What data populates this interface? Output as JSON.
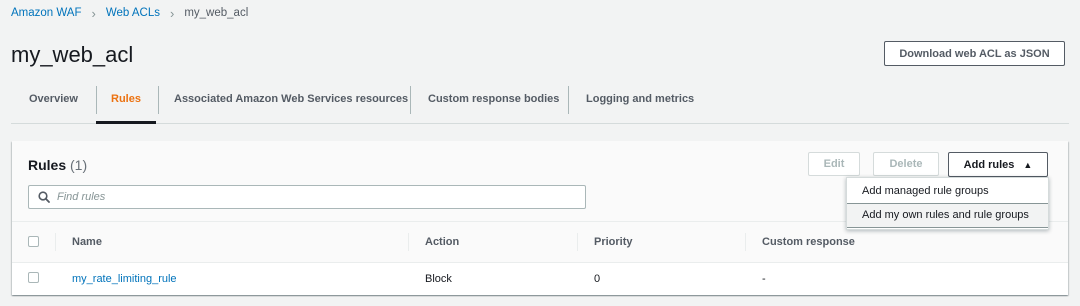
{
  "breadcrumb": {
    "items": [
      {
        "label": "Amazon WAF"
      },
      {
        "label": "Web ACLs"
      },
      {
        "label": "my_web_acl"
      }
    ]
  },
  "page": {
    "title": "my_web_acl",
    "download_label": "Download web ACL as JSON"
  },
  "tabs": [
    {
      "label": "Overview"
    },
    {
      "label": "Rules",
      "active": true
    },
    {
      "label": "Associated Amazon Web Services resources"
    },
    {
      "label": "Custom response bodies"
    },
    {
      "label": "Logging and metrics"
    }
  ],
  "rules_panel": {
    "title": "Rules",
    "count": "(1)",
    "edit_label": "Edit",
    "delete_label": "Delete",
    "add_rules_label": "Add rules",
    "search_placeholder": "Find rules",
    "columns": [
      "Name",
      "Action",
      "Priority",
      "Custom response"
    ],
    "rows": [
      {
        "name": "my_rate_limiting_rule",
        "action": "Block",
        "priority": "0",
        "custom_response": "-"
      }
    ]
  },
  "add_rules_menu": {
    "items": [
      {
        "label": "Add managed rule groups"
      },
      {
        "label": "Add my own rules and rule groups",
        "highlighted": true
      }
    ]
  },
  "colors": {
    "accent_orange": "#ec7211",
    "link_blue": "#0073bb",
    "background": "#f2f3f3"
  }
}
